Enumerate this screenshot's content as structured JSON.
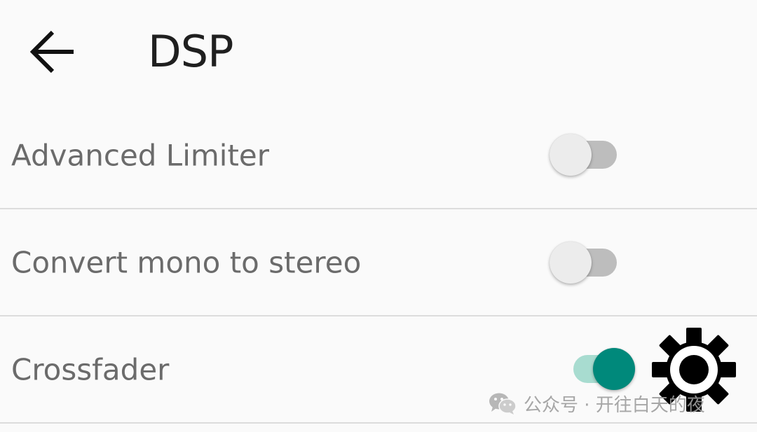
{
  "header": {
    "back_icon": "arrow-left-icon",
    "title": "DSP"
  },
  "settings": [
    {
      "label": "Advanced Limiter",
      "enabled": false
    },
    {
      "label": "Convert mono to stereo",
      "enabled": false
    },
    {
      "label": "Crossfader",
      "enabled": true
    }
  ],
  "overlay": {
    "icon": "gear-icon"
  },
  "watermark": {
    "icon": "wechat-logo-icon",
    "text": "公众号 · 开往白天的夜"
  },
  "colors": {
    "background": "#fafafa",
    "accent": "#00897b",
    "accent_track": "#a8dcd0",
    "switch_off_track": "#bdbdbd",
    "switch_off_thumb": "#ececec",
    "label_text": "#6b6b6b",
    "title_text": "#1f1f1f",
    "divider": "#dcdcdc"
  }
}
